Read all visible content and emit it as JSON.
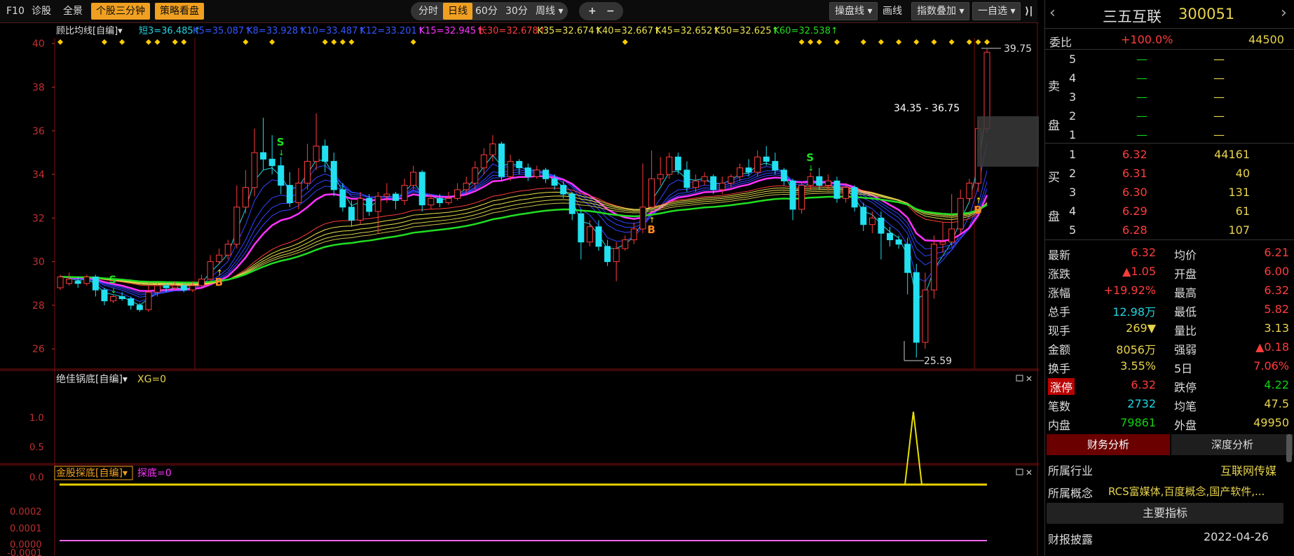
{
  "toolbar": {
    "left": [
      "F10",
      "诊股",
      "全景",
      "个股三分钟",
      "策略看盘"
    ],
    "periods": [
      "分时",
      "日线",
      "60分",
      "30分",
      "周线 ▾"
    ],
    "zoom": [
      "+",
      "−"
    ],
    "right": [
      "操盘线 ▾",
      "画线",
      "指数叠加 ▾",
      "一自选 ▾"
    ],
    "close_icon": "collapse-icon"
  },
  "main_indicator": {
    "name": "顾比均线[自编]▾",
    "items": [
      {
        "label": "短3=36.485↑",
        "color": "#22d4e0"
      },
      {
        "label": "K5=35.087↑",
        "color": "#3355ff"
      },
      {
        "label": "K8=33.928↑",
        "color": "#3355ff"
      },
      {
        "label": "K10=33.487↑",
        "color": "#3355ff"
      },
      {
        "label": "K12=33.201↑",
        "color": "#3355ff"
      },
      {
        "label": "K15=32.945↑",
        "color": "#ff33ff"
      },
      {
        "label": "长30=32.678↑",
        "color": "#ff3c3c"
      },
      {
        "label": "K35=32.674↑",
        "color": "#e8e04c"
      },
      {
        "label": "K40=32.667↑",
        "color": "#e8e04c"
      },
      {
        "label": "K45=32.652↑",
        "color": "#e8e04c"
      },
      {
        "label": "K50=32.625↑",
        "color": "#e8e04c"
      },
      {
        "label": "K60=32.538↑",
        "color": "#22dd22"
      }
    ],
    "y_ticks": [
      "40",
      "38",
      "36",
      "34",
      "32",
      "30",
      "28",
      "26"
    ],
    "high_label": "39.75",
    "low_label": "25.59",
    "range_label": "34.35 - 36.75"
  },
  "chart_data": {
    "type": "candlestick",
    "ylim": [
      25.3,
      40.2
    ],
    "candles": [
      [
        28.8,
        29.3,
        28.7,
        29.4
      ],
      [
        29.0,
        29.2,
        28.9,
        29.5
      ],
      [
        29.1,
        29.0,
        28.8,
        29.3
      ],
      [
        29.0,
        29.3,
        28.9,
        29.4
      ],
      [
        29.3,
        28.7,
        28.4,
        29.4
      ],
      [
        28.7,
        28.2,
        28.0,
        28.8
      ],
      [
        28.2,
        28.4,
        28.1,
        28.5
      ],
      [
        28.4,
        28.3,
        28.2,
        28.6
      ],
      [
        28.3,
        28.0,
        27.8,
        28.4
      ],
      [
        28.0,
        27.8,
        27.7,
        28.1
      ],
      [
        27.8,
        28.6,
        27.7,
        28.9
      ],
      [
        28.6,
        28.9,
        28.4,
        29.0
      ],
      [
        28.9,
        28.8,
        28.6,
        29.0
      ],
      [
        28.8,
        28.9,
        28.7,
        29.1
      ],
      [
        28.9,
        28.7,
        28.6,
        29.0
      ],
      [
        28.7,
        28.9,
        28.6,
        29.1
      ],
      [
        28.9,
        29.2,
        28.8,
        29.4
      ],
      [
        29.2,
        30.0,
        29.1,
        30.3
      ],
      [
        30.0,
        30.3,
        29.9,
        30.6
      ],
      [
        30.3,
        30.8,
        30.1,
        31.0
      ],
      [
        30.8,
        32.5,
        30.6,
        33.5
      ],
      [
        32.5,
        33.4,
        32.2,
        34.2
      ],
      [
        33.4,
        35.0,
        33.0,
        36.1
      ],
      [
        35.0,
        34.7,
        34.2,
        36.6
      ],
      [
        34.7,
        34.4,
        34.0,
        35.8
      ],
      [
        34.4,
        33.5,
        33.1,
        34.8
      ],
      [
        33.5,
        32.7,
        32.5,
        34.1
      ],
      [
        32.7,
        33.6,
        32.4,
        34.3
      ],
      [
        33.6,
        34.6,
        33.3,
        35.4
      ],
      [
        34.6,
        35.3,
        34.2,
        36.8
      ],
      [
        35.3,
        34.6,
        34.1,
        35.6
      ],
      [
        34.6,
        33.3,
        33.0,
        35.0
      ],
      [
        33.3,
        32.5,
        32.3,
        33.6
      ],
      [
        32.5,
        31.9,
        31.6,
        32.8
      ],
      [
        31.9,
        32.9,
        31.7,
        33.2
      ],
      [
        32.9,
        32.3,
        32.1,
        33.1
      ],
      [
        32.3,
        33.0,
        31.3,
        33.2
      ],
      [
        33.0,
        33.1,
        32.7,
        33.6
      ],
      [
        33.1,
        32.8,
        32.4,
        33.2
      ],
      [
        32.8,
        33.5,
        32.6,
        33.8
      ],
      [
        33.5,
        34.1,
        33.3,
        34.4
      ],
      [
        34.1,
        32.6,
        32.3,
        34.2
      ],
      [
        32.6,
        32.9,
        32.4,
        33.1
      ],
      [
        32.9,
        32.7,
        32.5,
        33.1
      ],
      [
        32.7,
        32.9,
        32.6,
        33.2
      ],
      [
        32.9,
        33.3,
        32.8,
        33.6
      ],
      [
        33.3,
        33.6,
        33.1,
        33.9
      ],
      [
        33.6,
        34.3,
        33.3,
        34.6
      ],
      [
        34.3,
        34.9,
        34.0,
        35.2
      ],
      [
        34.9,
        35.4,
        34.6,
        35.8
      ],
      [
        35.4,
        33.9,
        33.7,
        35.5
      ],
      [
        33.9,
        34.6,
        33.7,
        34.9
      ],
      [
        34.6,
        34.3,
        34.0,
        34.7
      ],
      [
        34.3,
        33.9,
        33.7,
        34.5
      ],
      [
        33.9,
        34.2,
        33.8,
        34.4
      ],
      [
        34.2,
        33.8,
        33.6,
        34.3
      ],
      [
        33.8,
        33.5,
        33.3,
        34.0
      ],
      [
        33.5,
        33.1,
        32.9,
        33.7
      ],
      [
        33.1,
        32.2,
        31.9,
        33.2
      ],
      [
        32.2,
        30.9,
        30.1,
        32.4
      ],
      [
        30.9,
        31.6,
        30.7,
        31.9
      ],
      [
        31.6,
        30.7,
        30.5,
        31.9
      ],
      [
        30.7,
        30.0,
        29.8,
        31.0
      ],
      [
        30.0,
        30.6,
        29.1,
        30.9
      ],
      [
        30.6,
        31.0,
        30.5,
        31.2
      ],
      [
        31.0,
        31.5,
        30.8,
        31.8
      ],
      [
        31.5,
        32.5,
        31.3,
        34.5
      ],
      [
        32.5,
        33.8,
        32.3,
        35.1
      ],
      [
        33.8,
        34.0,
        33.5,
        34.8
      ],
      [
        34.0,
        34.8,
        33.8,
        35.0
      ],
      [
        34.8,
        34.2,
        34.0,
        35.0
      ],
      [
        34.2,
        33.4,
        33.2,
        34.6
      ],
      [
        33.4,
        33.7,
        33.2,
        34.0
      ],
      [
        33.7,
        33.9,
        33.5,
        34.1
      ],
      [
        33.9,
        33.3,
        33.1,
        34.0
      ],
      [
        33.3,
        33.6,
        33.1,
        33.9
      ],
      [
        33.6,
        33.9,
        33.4,
        34.0
      ],
      [
        33.9,
        34.3,
        33.7,
        34.5
      ],
      [
        34.3,
        34.1,
        33.9,
        34.7
      ],
      [
        34.1,
        34.8,
        33.9,
        35.1
      ],
      [
        34.8,
        34.6,
        34.4,
        35.3
      ],
      [
        34.6,
        34.2,
        34.0,
        35.0
      ],
      [
        34.2,
        33.7,
        33.5,
        34.3
      ],
      [
        33.7,
        32.4,
        31.9,
        33.8
      ],
      [
        32.4,
        33.5,
        32.2,
        33.7
      ],
      [
        33.5,
        33.9,
        33.3,
        34.1
      ],
      [
        33.9,
        33.5,
        33.3,
        34.3
      ],
      [
        33.5,
        33.7,
        33.3,
        34.0
      ],
      [
        33.7,
        32.9,
        32.7,
        33.9
      ],
      [
        32.9,
        33.4,
        32.7,
        33.6
      ],
      [
        33.4,
        32.5,
        32.3,
        33.5
      ],
      [
        32.5,
        31.7,
        31.4,
        32.7
      ],
      [
        31.7,
        32.0,
        31.3,
        32.3
      ],
      [
        32.0,
        31.3,
        30.1,
        32.3
      ],
      [
        31.3,
        31.0,
        30.7,
        31.6
      ],
      [
        31.0,
        30.8,
        30.6,
        31.2
      ],
      [
        30.8,
        29.5,
        28.5,
        31.1
      ],
      [
        29.5,
        26.3,
        25.6,
        29.9
      ],
      [
        26.3,
        28.7,
        26.0,
        29.5
      ],
      [
        28.7,
        30.8,
        28.3,
        31.2
      ],
      [
        30.8,
        30.9,
        30.4,
        31.8
      ],
      [
        30.9,
        31.5,
        30.7,
        33.1
      ],
      [
        31.5,
        32.9,
        31.3,
        33.3
      ],
      [
        32.9,
        33.6,
        32.7,
        33.8
      ],
      [
        33.6,
        36.1,
        33.2,
        36.5
      ],
      [
        36.1,
        39.6,
        35.9,
        39.75
      ]
    ],
    "signals": {
      "S": [
        6,
        25,
        85
      ],
      "B": [
        18,
        67,
        104
      ]
    },
    "top_marks": [
      0,
      5,
      7,
      10,
      11,
      13,
      14,
      21,
      24,
      30,
      31,
      32,
      33,
      40,
      64,
      84,
      85,
      86,
      88,
      91,
      93,
      95,
      97,
      99,
      101,
      103,
      104,
      105
    ]
  },
  "sub1": {
    "name": "绝佳锅底[自编]▾",
    "value_label": "XG=0",
    "y_ticks": [
      "1.0",
      "0.5",
      "0.0"
    ]
  },
  "sub2": {
    "name": "金股探底[自编]▾",
    "value_label": "探底=0",
    "y_ticks": [
      "0.0002",
      "0.0001",
      "0.0000",
      "-0.0001"
    ]
  },
  "panel": {
    "stock_name": "三五互联",
    "stock_code": "300051",
    "webi": {
      "label": "委比",
      "value": "+100.0%",
      "vol": "44500"
    },
    "sell": {
      "label": "卖盘",
      "rows": [
        [
          "5",
          "—",
          "—"
        ],
        [
          "4",
          "—",
          "—"
        ],
        [
          "3",
          "—",
          "—"
        ],
        [
          "2",
          "—",
          "—"
        ],
        [
          "1",
          "—",
          "—"
        ]
      ]
    },
    "buy": {
      "label": "买盘",
      "rows": [
        [
          "1",
          "6.32",
          "44161"
        ],
        [
          "2",
          "6.31",
          "40"
        ],
        [
          "3",
          "6.30",
          "131"
        ],
        [
          "4",
          "6.29",
          "61"
        ],
        [
          "5",
          "6.28",
          "107"
        ]
      ]
    },
    "stats": [
      [
        "最新",
        "6.32",
        "均价",
        "6.21"
      ],
      [
        "涨跌",
        "▲1.05",
        "开盘",
        "6.00"
      ],
      [
        "涨幅",
        "+19.92%",
        "最高",
        "6.32"
      ],
      [
        "总手",
        "12.98万",
        "最低",
        "5.82"
      ],
      [
        "现手",
        "269▼",
        "量比",
        "3.13"
      ],
      [
        "金额",
        "8056万",
        "强弱",
        "▲0.18"
      ],
      [
        "换手",
        "3.55%",
        "5日",
        "7.06%"
      ],
      [
        "涨停",
        "6.32",
        "跌停",
        "4.22"
      ],
      [
        "笔数",
        "2732",
        "均笔",
        "47.5"
      ],
      [
        "内盘",
        "79861",
        "外盘",
        "49950"
      ]
    ],
    "tabs": [
      "财务分析",
      "深度分析"
    ],
    "industry": {
      "label": "所属行业",
      "value": "互联网传媒"
    },
    "concept": {
      "label": "所属概念",
      "value": "RCS富媒体,百度概念,国产软件,..."
    },
    "main_btn": "主要指标",
    "report": {
      "label": "财报披露",
      "value": "2022-04-26"
    }
  }
}
